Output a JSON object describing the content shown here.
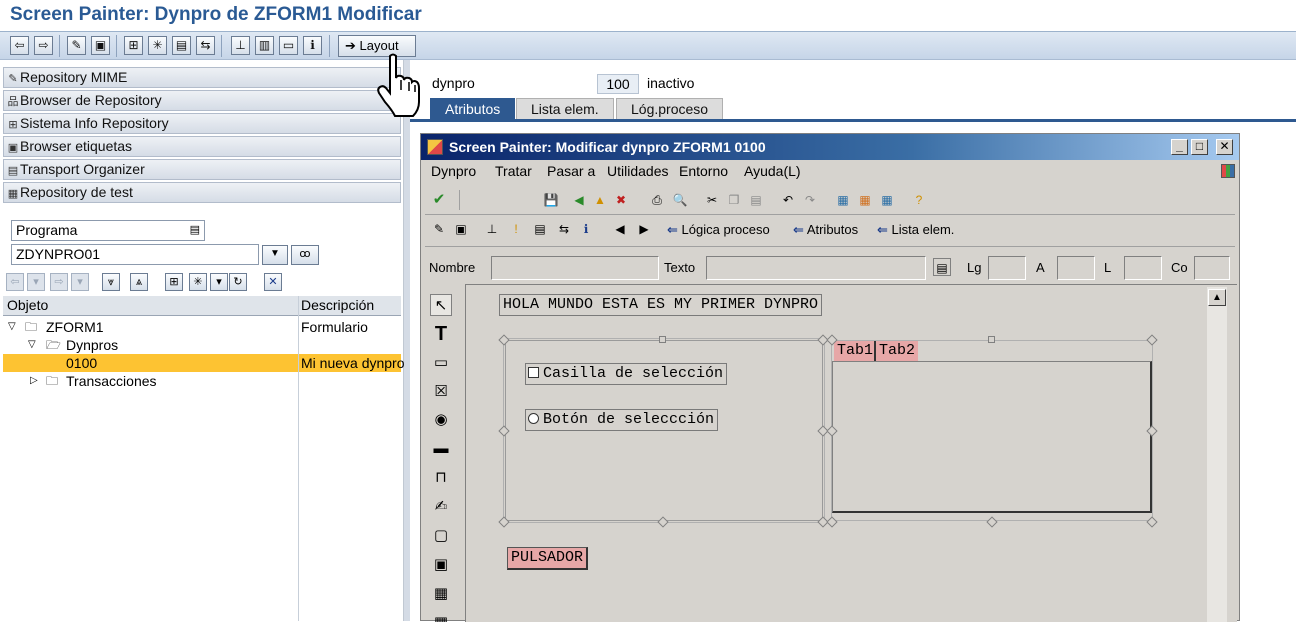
{
  "window": {
    "title": "Screen Painter: Dynpro de ZFORM1 Modificar"
  },
  "app_toolbar": {
    "icons": [
      "back-icon",
      "forward-icon",
      "toggle-display-change-icon",
      "other-object-icon",
      "object-list-icon",
      "where-used-icon",
      "display-object-list-icon",
      "navigation-window-icon",
      "hierarchy-icon",
      "print-icon",
      "layout-window-icon",
      "info-icon"
    ],
    "layout_label": "Layout"
  },
  "nav": {
    "items": [
      {
        "label": "Repository MIME",
        "icon": "pencil-icon"
      },
      {
        "label": "Browser de Repository",
        "icon": "hierarchy-icon"
      },
      {
        "label": "Sistema Info Repository",
        "icon": "info-system-icon"
      },
      {
        "label": "Browser etiquetas",
        "icon": "tag-icon"
      },
      {
        "label": "Transport Organizer",
        "icon": "truck-icon"
      },
      {
        "label": "Repository de test",
        "icon": "test-icon"
      }
    ]
  },
  "object_selector": {
    "type_value": "Programa",
    "name_value": "ZDYNPRO01"
  },
  "tree": {
    "columns": [
      "Objeto",
      "Descripción"
    ],
    "rows": [
      {
        "name": "ZFORM1",
        "desc": "Formulario"
      },
      {
        "name": "Dynpros",
        "desc": ""
      },
      {
        "name": "0100",
        "desc": "Mi nueva dynpro"
      },
      {
        "name": "Transacciones",
        "desc": ""
      }
    ]
  },
  "dynpro_header": {
    "label": "dynpro",
    "number": "100",
    "status": "inactivo"
  },
  "tabs": [
    "Atributos",
    "Lista elem.",
    "Lóg.proceso"
  ],
  "painter": {
    "title": "Screen Painter:  Modificar dynpro ZFORM1 0100",
    "menu": [
      "Dynpro",
      "Tratar",
      "Pasar a",
      "Utilidades",
      "Entorno",
      "Ayuda(L)"
    ],
    "nav_links": [
      "Lógica proceso",
      "Atributos",
      "Lista elem."
    ],
    "attr_labels": [
      "Nombre",
      "Texto",
      "Lg",
      "A",
      "L",
      "Co"
    ],
    "canvas": {
      "text_field": "HOLA MUNDO ESTA ES MY PRIMER DYNPRO",
      "checkbox_label": "Casilla de selección",
      "radio_label": "Botón de seleccción",
      "tab_labels": [
        "Tab1",
        "Tab2"
      ],
      "button_label": "PULSADOR"
    }
  },
  "colors": {
    "title": "#2a5a94",
    "active_tab": "#2e5990",
    "selected_row": "#fdc332",
    "tab_strip": "#e7a7a7"
  }
}
